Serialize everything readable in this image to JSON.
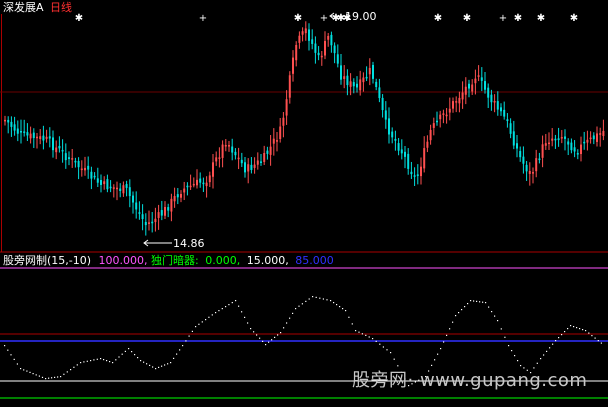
{
  "header": {
    "stock_name": "深发展A",
    "period": "日线"
  },
  "price_panel": {
    "high_label": "19.00",
    "low_label": "14.86",
    "star_marker": "✱",
    "cross_marker": "+"
  },
  "indicator_panel": {
    "name": "股旁网制(15,-10)",
    "values": [
      {
        "text": "100.000,",
        "color": "#ff55ff"
      },
      {
        "text": "独门暗器:",
        "color": "#00ff00"
      },
      {
        "text": "0.000,",
        "color": "#00ff00"
      },
      {
        "text": "15.000,",
        "color": "#ffffff"
      },
      {
        "text": "85.000",
        "color": "#3030ff"
      }
    ]
  },
  "watermark": "股旁网· www.gupang.com",
  "colors": {
    "background": "#000000",
    "up_candle": "#ff5050",
    "down_candle": "#00e0e0",
    "separator": "#aa0000",
    "level_100": "#ff55ff",
    "level_85": "#3030ff",
    "level_15": "#ffffff",
    "level_0": "#00ff00"
  }
}
